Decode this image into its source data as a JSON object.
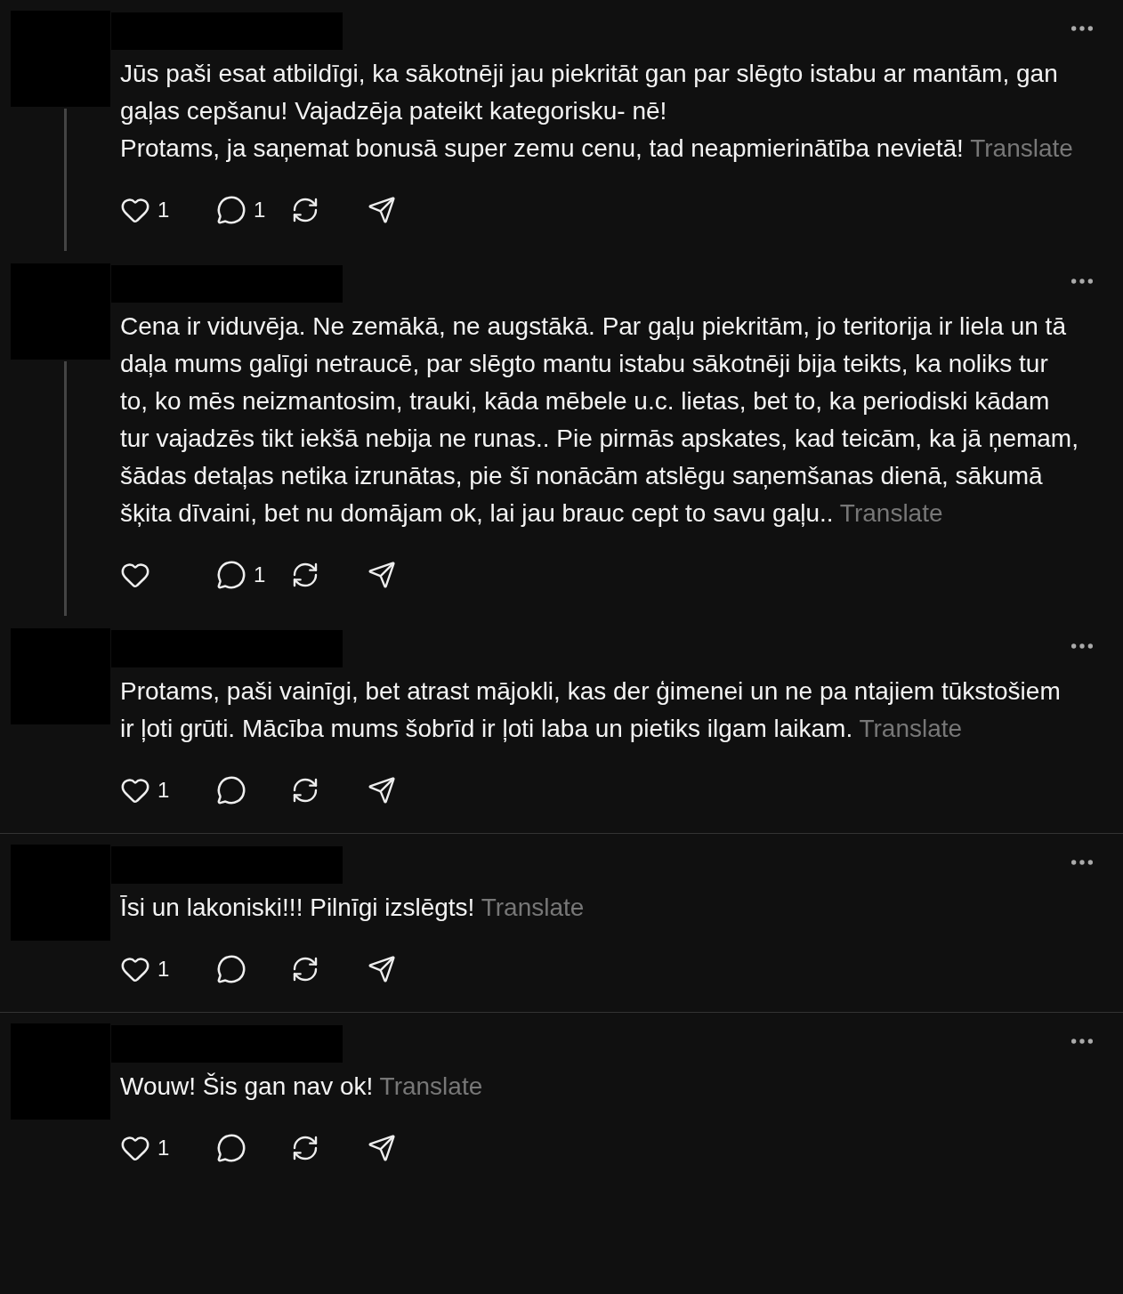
{
  "posts": [
    {
      "text": "Jūs paši esat atbildīgi, ka sākotnēji jau piekritāt gan par slēgto istabu ar mantām, gan gaļas cepšanu! Vajadzēja pateikt kategorisku- nē!\nProtams, ja saņemat bonusā super zemu cenu, tad neapmierinātība nevietā!",
      "translate": "Translate",
      "likes": "1",
      "replies": "1",
      "thread_line": true,
      "divider_after": false
    },
    {
      "text": "Cena ir viduvēja. Ne zemākā, ne augstākā. Par gaļu piekritām, jo teritorija ir liela un tā daļa mums galīgi netraucē, par slēgto mantu istabu sākotnēji bija teikts, ka noliks tur to, ko mēs neizmantosim, trauki, kāda mēbele u.c. lietas, bet to, ka periodiski kādam tur vajadzēs tikt iekšā nebija ne runas.. Pie pirmās apskates, kad teicām, ka jā ņemam, šādas detaļas netika izrunātas, pie šī nonācām atslēgu saņemšanas dienā, sākumā šķita dīvaini, bet nu domājam ok, lai jau brauc cept to savu gaļu..",
      "translate": "Translate",
      "replies": "1",
      "thread_line": true,
      "divider_after": false
    },
    {
      "text": "Protams, paši vainīgi, bet atrast mājokli, kas der ģimenei un ne pa ntajiem tūkstošiem ir ļoti grūti. Mācība mums šobrīd ir ļoti laba un pietiks ilgam laikam.",
      "translate": "Translate",
      "likes": "1",
      "thread_line": false,
      "divider_after": true
    },
    {
      "text": "Īsi un lakoniski!!! Pilnīgi izslēgts!",
      "translate": "Translate",
      "likes": "1",
      "thread_line": false,
      "divider_after": true
    },
    {
      "text": "Wouw! Šis gan nav ok!",
      "translate": "Translate",
      "likes": "1",
      "thread_line": false,
      "divider_after": false
    }
  ]
}
